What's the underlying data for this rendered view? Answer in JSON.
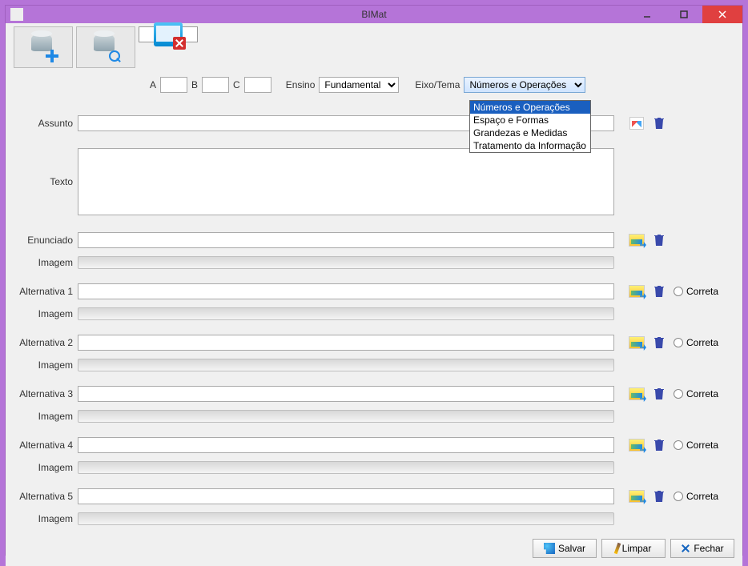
{
  "title": "BIMat",
  "toprow": {
    "a": "A",
    "b": "B",
    "c": "C",
    "ensino_label": "Ensino",
    "ensino_value": "Fundamental",
    "eixo_label": "Eixo/Tema",
    "eixo_value": "Números e Operações",
    "eixo_options": [
      "Números e Operações",
      "Espaço e Formas",
      "Grandezas e Medidas",
      "Tratamento da Informação"
    ]
  },
  "labels": {
    "assunto": "Assunto",
    "texto": "Texto",
    "enunciado": "Enunciado",
    "imagem": "Imagem",
    "alt1": "Alternativa 1",
    "alt2": "Alternativa 2",
    "alt3": "Alternativa 3",
    "alt4": "Alternativa 4",
    "alt5": "Alternativa 5",
    "correta": "Correta"
  },
  "footer": {
    "salvar": "Salvar",
    "limpar": "Limpar",
    "fechar": "Fechar"
  }
}
